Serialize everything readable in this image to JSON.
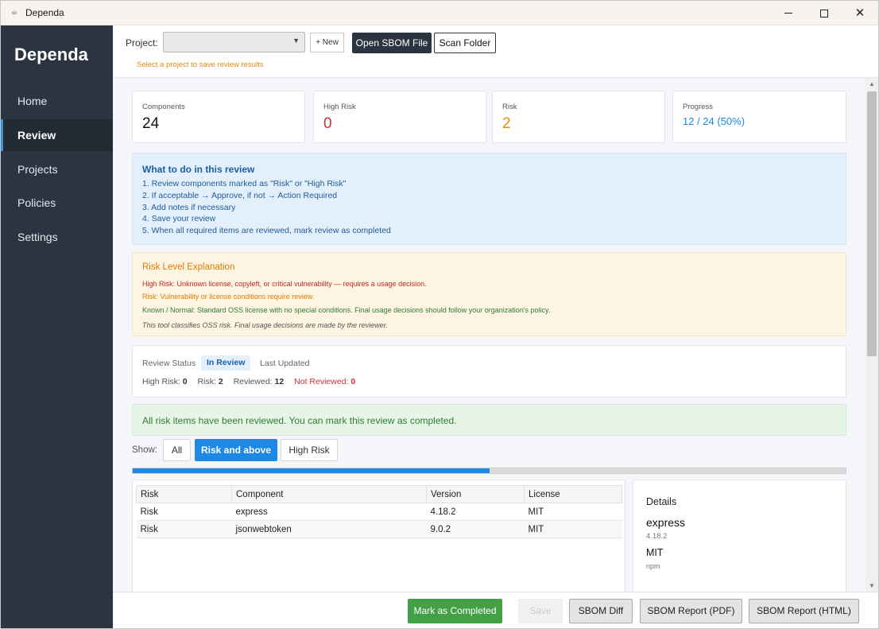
{
  "window": {
    "title": "Dependa",
    "icon": "app-logo-icon"
  },
  "sidebar": {
    "brand": "Dependa",
    "items": [
      {
        "label": "Home",
        "active": false
      },
      {
        "label": "Review",
        "active": true
      },
      {
        "label": "Projects",
        "active": false
      },
      {
        "label": "Policies",
        "active": false
      },
      {
        "label": "Settings",
        "active": false
      }
    ]
  },
  "toolbar": {
    "project_label": "Project:",
    "project_value": "",
    "new_label": "+ New",
    "open_label": "Open SBOM File",
    "scan_label": "Scan Folder",
    "hint": "Select a project to save review results"
  },
  "stats": [
    {
      "label": "Components",
      "value": "24",
      "color": "#111111"
    },
    {
      "label": "High Risk",
      "value": "0",
      "color": "#d32f2f"
    },
    {
      "label": "Risk",
      "value": "2",
      "color": "#f08a00"
    },
    {
      "label": "Progress",
      "value": "12 / 24 (50%)",
      "color": "#1e88e5"
    }
  ],
  "help": {
    "title": "What to do in this review",
    "steps": [
      "1. Review components marked as \"Risk\" or \"High Risk\"",
      "2. If acceptable → Approve, if not → Action Required",
      "3. Add notes if necessary",
      "4. Save your review",
      "5. When all required items are reviewed, mark review as completed"
    ]
  },
  "risk_explanation": {
    "title": "Risk Level Explanation",
    "high": "High Risk: Unknown license, copyleft, or critical vulnerability — requires a usage decision.",
    "risk": "Risk: Vulnerability or license conditions require review.",
    "normal": "Known / Normal: Standard OSS license with no special conditions. Final usage decisions should follow your organization's policy.",
    "note": "This tool classifies OSS risk. Final usage decisions are made by the reviewer."
  },
  "review_status": {
    "label": "Review Status",
    "status": "In Review",
    "last_updated_label": "Last Updated",
    "high_risk_label": "High Risk:",
    "high_risk_value": "0",
    "risk_label": "Risk:",
    "risk_value": "2",
    "reviewed_label": "Reviewed:",
    "reviewed_value": "12",
    "not_reviewed_label": "Not Reviewed:",
    "not_reviewed_value": "0"
  },
  "success_message": "All risk items have been reviewed. You can mark this review as completed.",
  "filter": {
    "label": "Show:",
    "options": [
      "All",
      "Risk and above",
      "High Risk"
    ],
    "selected": "Risk and above"
  },
  "review_progress": 0.5,
  "table": {
    "columns": [
      "Risk",
      "Component",
      "Version",
      "License"
    ],
    "rows": [
      [
        "Risk",
        "express",
        "4.18.2",
        "MIT"
      ],
      [
        "Risk",
        "jsonwebtoken",
        "9.0.2",
        "MIT"
      ]
    ]
  },
  "details": {
    "title": "Details",
    "name": "express",
    "version": "4.18.2",
    "license": "MIT",
    "ecosystem": "npm"
  },
  "bottom_bar": {
    "complete": "Mark as Completed",
    "save": "Save",
    "diff": "SBOM Diff",
    "pdf": "SBOM Report (PDF)",
    "html": "SBOM Report (HTML)"
  },
  "colors": {
    "sidebar": "#2b3440",
    "accent": "#1e88e5",
    "success": "#43a047"
  }
}
